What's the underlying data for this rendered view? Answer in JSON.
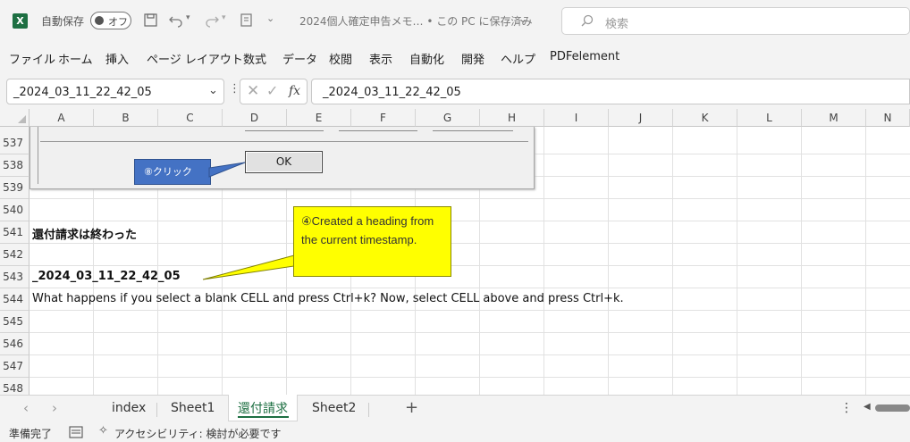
{
  "titlebar": {
    "autosave_label": "自動保存",
    "autosave_toggle": "オフ",
    "doc_title": "2024個人確定申告メモ… • この PC に保存済み",
    "search_placeholder": "検索"
  },
  "ribbon": {
    "tabs": [
      "ファイル",
      "ホーム",
      "挿入",
      "ページ レイアウト",
      "数式",
      "データ",
      "校閲",
      "表示",
      "自動化",
      "開発",
      "ヘルプ",
      "PDFelement"
    ]
  },
  "formula_bar": {
    "name_box": "_2024_03_11_22_42_05",
    "fx_label": "fx",
    "formula_value": "_2024_03_11_22_42_05"
  },
  "grid": {
    "columns": [
      "A",
      "B",
      "C",
      "D",
      "E",
      "F",
      "G",
      "H",
      "I",
      "J",
      "K",
      "L",
      "M",
      "N"
    ],
    "rows": [
      "537",
      "538",
      "539",
      "540",
      "541",
      "542",
      "543",
      "544",
      "545",
      "546",
      "547",
      "548"
    ],
    "cells": {
      "a541": "還付請求は終わった",
      "a543": "_2024_03_11_22_42_05",
      "a544": "What happens if you select a blank CELL and press Ctrl+k? Now, select CELL above and press Ctrl+k."
    }
  },
  "dialog": {
    "ok_label": "OK",
    "annotation": "⑧クリック"
  },
  "callout": {
    "text": "④Created a heading from the current timestamp."
  },
  "sheet_tabs": {
    "tabs": [
      "index",
      "Sheet1",
      "還付請求",
      "Sheet2"
    ],
    "active": "還付請求",
    "add_label": "+"
  },
  "statusbar": {
    "ready": "準備完了",
    "accessibility": "アクセシビリティ: 検討が必要です"
  },
  "colors": {
    "excel_green": "#1d6f42",
    "callout_fill": "#ffff00",
    "annotation_fill": "#4472c4"
  }
}
